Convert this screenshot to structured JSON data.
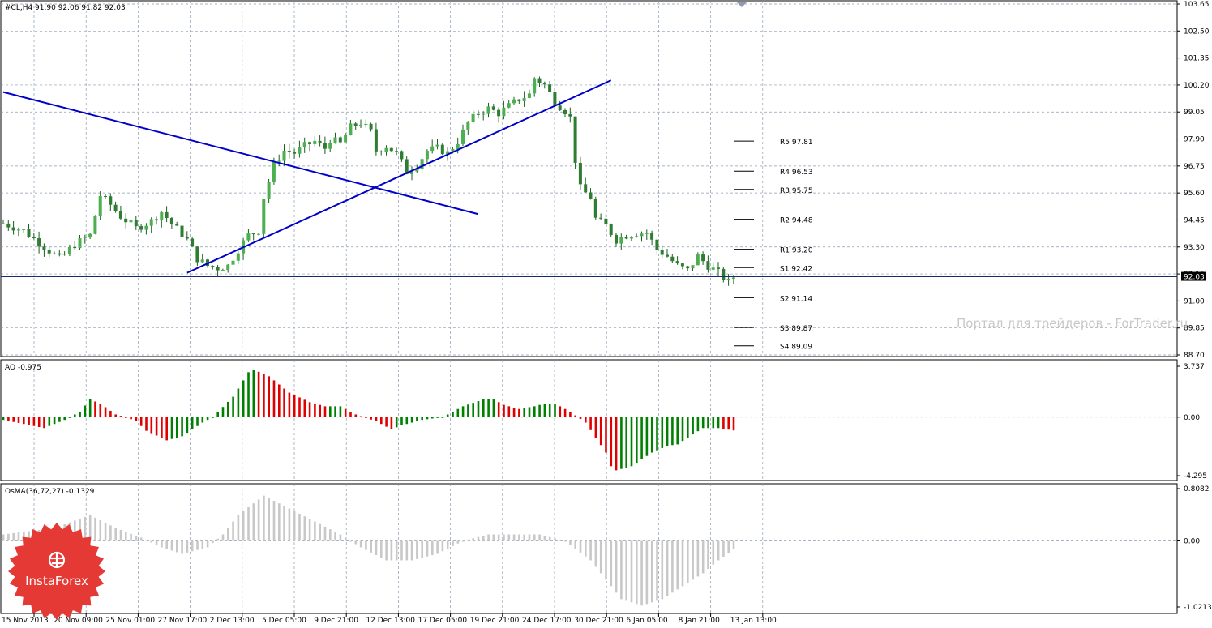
{
  "chart_data": [
    {
      "type": "candlestick",
      "title": "#CL,H4  91.90 92.06 91.82 92.03",
      "ylim": [
        88.7,
        103.65
      ],
      "y_ticks": [
        "103.65",
        "102.50",
        "101.35",
        "100.20",
        "99.05",
        "97.90",
        "96.75",
        "95.60",
        "94.45",
        "93.30",
        "92.15",
        "91.00",
        "89.85",
        "88.70"
      ],
      "current_price": "92.03",
      "x_ticks": [
        "15 Nov 2013",
        "20 Nov 09:00",
        "25 Nov 01:00",
        "27 Nov 17:00",
        "2 Dec 13:00",
        "5 Dec 05:00",
        "9 Dec 21:00",
        "12 Dec 13:00",
        "17 Dec 05:00",
        "19 Dec 21:00",
        "24 Dec 17:00",
        "30 Dec 21:00",
        "6 Jan 05:00",
        "8 Jan 21:00",
        "13 Jan 13:00"
      ],
      "close_path": [
        [
          0,
          94.3
        ],
        [
          4,
          94.0
        ],
        [
          8,
          93.3
        ],
        [
          11,
          92.8
        ],
        [
          14,
          93.4
        ],
        [
          17,
          93.8
        ],
        [
          19,
          95.5
        ],
        [
          21,
          95.1
        ],
        [
          23,
          94.6
        ],
        [
          26,
          94.1
        ],
        [
          29,
          94.4
        ],
        [
          31,
          94.8
        ],
        [
          33,
          94.3
        ],
        [
          36,
          93.6
        ],
        [
          38,
          92.8
        ],
        [
          40,
          92.5
        ],
        [
          42,
          92.4
        ],
        [
          44,
          92.5
        ],
        [
          46,
          93.2
        ],
        [
          48,
          93.8
        ],
        [
          50,
          94.0
        ],
        [
          51,
          95.4
        ],
        [
          53,
          96.8
        ],
        [
          55,
          97.4
        ],
        [
          57,
          97.3
        ],
        [
          59,
          97.6
        ],
        [
          61,
          97.8
        ],
        [
          63,
          97.5
        ],
        [
          64,
          97.9
        ],
        [
          66,
          97.7
        ],
        [
          68,
          98.4
        ],
        [
          70,
          98.6
        ],
        [
          72,
          98.2
        ],
        [
          73,
          97.4
        ],
        [
          75,
          97.6
        ],
        [
          77,
          97.3
        ],
        [
          79,
          96.5
        ],
        [
          81,
          96.8
        ],
        [
          83,
          97.4
        ],
        [
          85,
          97.5
        ],
        [
          87,
          97.3
        ],
        [
          89,
          97.8
        ],
        [
          91,
          98.6
        ],
        [
          93,
          99.0
        ],
        [
          95,
          99.2
        ],
        [
          97,
          99.0
        ],
        [
          99,
          99.3
        ],
        [
          101,
          99.6
        ],
        [
          103,
          99.8
        ],
        [
          104,
          100.5
        ],
        [
          106,
          100.2
        ],
        [
          108,
          99.5
        ],
        [
          110,
          99.1
        ],
        [
          111,
          98.8
        ],
        [
          112,
          97.0
        ],
        [
          113,
          95.8
        ],
        [
          115,
          95.4
        ],
        [
          116,
          94.5
        ],
        [
          118,
          94.2
        ],
        [
          120,
          93.6
        ],
        [
          122,
          93.8
        ],
        [
          124,
          93.9
        ],
        [
          126,
          93.9
        ],
        [
          128,
          93.2
        ],
        [
          130,
          92.9
        ],
        [
          132,
          92.5
        ],
        [
          134,
          92.3
        ],
        [
          136,
          92.9
        ],
        [
          138,
          92.5
        ],
        [
          140,
          92.2
        ],
        [
          142,
          91.8
        ],
        [
          143,
          92.03
        ]
      ],
      "trend_lines": [
        {
          "from": [
            0,
            99.9
          ],
          "to": [
            93,
            94.7
          ]
        },
        {
          "from": [
            36,
            92.2
          ],
          "to": [
            119,
            100.4
          ]
        }
      ],
      "pivot_levels": [
        {
          "label": "R5 97.81",
          "value": 97.81
        },
        {
          "label": "R4 96.53",
          "value": 96.53
        },
        {
          "label": "R3 95.75",
          "value": 95.75
        },
        {
          "label": "R2 94.48",
          "value": 94.48
        },
        {
          "label": "R1 93.20",
          "value": 93.2
        },
        {
          "label": "S1 92.42",
          "value": 92.42
        },
        {
          "label": "S2 91.14",
          "value": 91.14
        },
        {
          "label": "S3 89.87",
          "value": 89.87
        },
        {
          "label": "S4 89.09",
          "value": 89.09
        }
      ],
      "watermark": "Портал для трейдеров - ForTrader.ru",
      "colors": {
        "bull": "#4caf50",
        "bear": "#2e7d32",
        "wick": "#1b5e20",
        "line": "#0000c8",
        "grid": "#8c9bb0",
        "price_label_bg": "#000000"
      }
    },
    {
      "type": "histogram",
      "title": "AO -0.975",
      "ylim": [
        -4.295,
        3.737
      ],
      "y_ticks": [
        "3.737",
        "0.00",
        "-4.295"
      ],
      "profile": [
        [
          0,
          -0.2
        ],
        [
          8,
          -0.8
        ],
        [
          12,
          -0.2
        ],
        [
          15,
          0.4
        ],
        [
          17,
          1.3
        ],
        [
          19,
          1.0
        ],
        [
          22,
          0.2
        ],
        [
          24,
          0.0
        ],
        [
          26,
          -0.3
        ],
        [
          28,
          -1.0
        ],
        [
          32,
          -1.7
        ],
        [
          35,
          -1.4
        ],
        [
          39,
          -0.4
        ],
        [
          41,
          0.0
        ],
        [
          45,
          1.5
        ],
        [
          48,
          3.3
        ],
        [
          49,
          3.5
        ],
        [
          52,
          3.0
        ],
        [
          56,
          1.8
        ],
        [
          60,
          1.1
        ],
        [
          63,
          0.8
        ],
        [
          66,
          0.8
        ],
        [
          69,
          0.2
        ],
        [
          73,
          -0.3
        ],
        [
          76,
          -0.9
        ],
        [
          78,
          -0.6
        ],
        [
          82,
          -0.2
        ],
        [
          86,
          0.0
        ],
        [
          90,
          0.8
        ],
        [
          94,
          1.3
        ],
        [
          96,
          1.3
        ],
        [
          98,
          0.9
        ],
        [
          101,
          0.6
        ],
        [
          104,
          0.8
        ],
        [
          106,
          1.0
        ],
        [
          108,
          1.0
        ],
        [
          111,
          0.4
        ],
        [
          114,
          -0.4
        ],
        [
          116,
          -1.5
        ],
        [
          118,
          -2.6
        ],
        [
          119,
          -3.6
        ],
        [
          120,
          -3.9
        ],
        [
          123,
          -3.6
        ],
        [
          127,
          -2.6
        ],
        [
          130,
          -2.1
        ],
        [
          132,
          -2.0
        ],
        [
          134,
          -1.5
        ],
        [
          137,
          -0.8
        ],
        [
          140,
          -0.8
        ],
        [
          143,
          -0.975
        ]
      ],
      "colors": {
        "up": "#008000",
        "down": "#e00000"
      }
    },
    {
      "type": "histogram",
      "title": "OsMA(36,72,27) -0.1329",
      "ylim": [
        -1.0213,
        0.8082
      ],
      "y_ticks": [
        "0.8082",
        "0.00",
        "-1.0213"
      ],
      "profile": [
        [
          0,
          0.1
        ],
        [
          10,
          0.2
        ],
        [
          17,
          0.4
        ],
        [
          22,
          0.2
        ],
        [
          27,
          0.05
        ],
        [
          31,
          -0.1
        ],
        [
          35,
          -0.2
        ],
        [
          40,
          -0.1
        ],
        [
          43,
          0.1
        ],
        [
          46,
          0.4
        ],
        [
          51,
          0.7
        ],
        [
          56,
          0.5
        ],
        [
          61,
          0.3
        ],
        [
          66,
          0.1
        ],
        [
          70,
          -0.1
        ],
        [
          75,
          -0.3
        ],
        [
          80,
          -0.3
        ],
        [
          85,
          -0.2
        ],
        [
          90,
          0.0
        ],
        [
          95,
          0.1
        ],
        [
          100,
          0.1
        ],
        [
          105,
          0.1
        ],
        [
          110,
          0.0
        ],
        [
          115,
          -0.3
        ],
        [
          118,
          -0.6
        ],
        [
          121,
          -0.9
        ],
        [
          125,
          -1.0
        ],
        [
          129,
          -0.9
        ],
        [
          133,
          -0.7
        ],
        [
          137,
          -0.5
        ],
        [
          140,
          -0.3
        ],
        [
          143,
          -0.1329
        ]
      ],
      "colors": {
        "bar": "#c8c8c8"
      }
    }
  ],
  "logo": {
    "text": "InstaForex",
    "color": "#e53935"
  }
}
